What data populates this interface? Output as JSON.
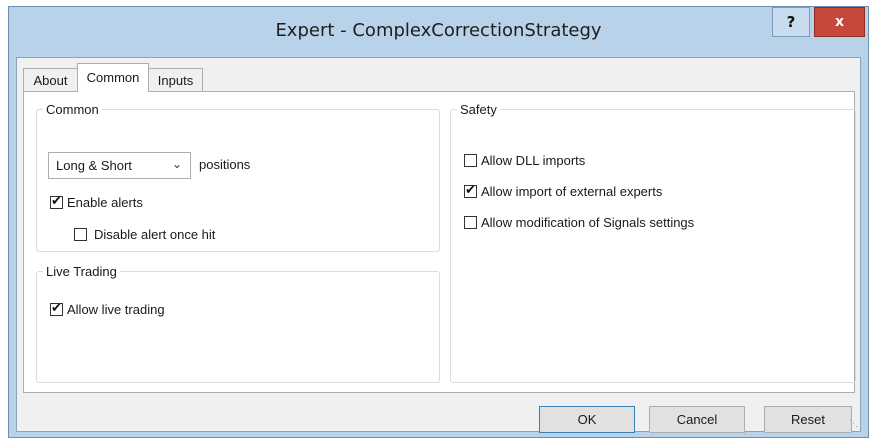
{
  "window": {
    "title": "Expert - ComplexCorrectionStrategy",
    "help_label": "?",
    "close_label": "x"
  },
  "tabs": [
    {
      "label": "About",
      "active": false
    },
    {
      "label": "Common",
      "active": true
    },
    {
      "label": "Inputs",
      "active": false
    }
  ],
  "common": {
    "legend": "Common",
    "positions_select": "Long & Short",
    "positions_label": "positions",
    "enable_alerts": {
      "label": "Enable alerts",
      "checked": true
    },
    "disable_alert_once_hit": {
      "label": "Disable alert once hit",
      "checked": false
    }
  },
  "live_trading": {
    "legend": "Live Trading",
    "allow_live_trading": {
      "label": "Allow live trading",
      "checked": true
    }
  },
  "safety": {
    "legend": "Safety",
    "allow_dll_imports": {
      "label": "Allow DLL imports",
      "checked": false
    },
    "allow_import_external": {
      "label": "Allow import of external experts",
      "checked": true
    },
    "allow_signals_modification": {
      "label": "Allow modification of Signals settings",
      "checked": false
    }
  },
  "buttons": {
    "ok": "OK",
    "cancel": "Cancel",
    "reset": "Reset"
  },
  "colors": {
    "frame": "#b8d2ea",
    "close": "#c6473b",
    "client": "#f0f0f0",
    "default_button_border": "#3c7fb1"
  }
}
